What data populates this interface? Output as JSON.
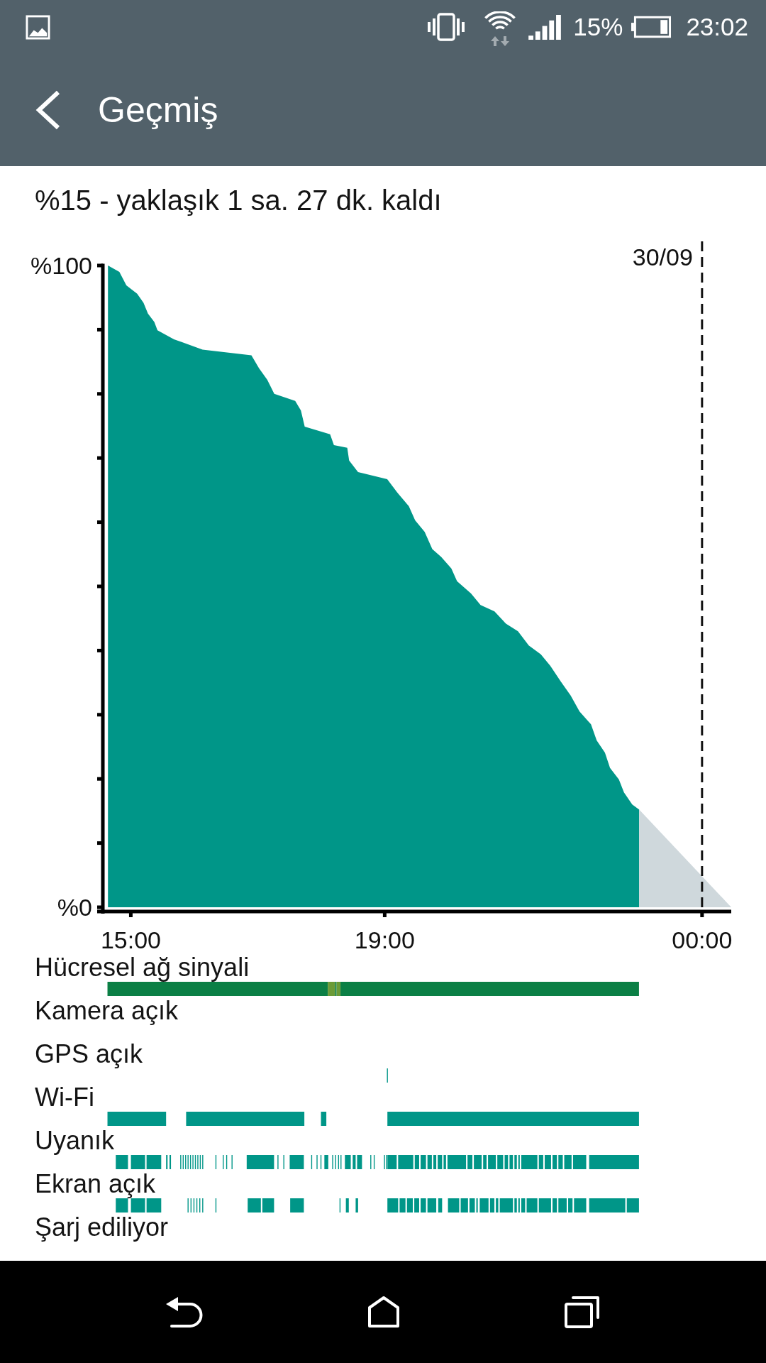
{
  "status_bar": {
    "battery_percent": "15%",
    "time": "23:02"
  },
  "app_bar": {
    "title": "Geçmiş"
  },
  "summary": "%15 - yaklaşık 1 sa. 27 dk. kaldı",
  "chart": {
    "date_label": "30/09",
    "chart_data": {
      "type": "area",
      "x": [
        14.64,
        14.82,
        14.93,
        15.1,
        15.2,
        15.27,
        15.37,
        15.42,
        15.68,
        16.13,
        16.9,
        17.02,
        17.15,
        17.26,
        17.59,
        17.68,
        17.74,
        18.14,
        18.2,
        18.41,
        18.44,
        18.58,
        19.04,
        19.2,
        19.38,
        19.48,
        19.63,
        19.75,
        19.89,
        20.05,
        20.14,
        20.36,
        20.51,
        20.73,
        20.91,
        21.1,
        21.27,
        21.46,
        21.61,
        21.78,
        21.93,
        22.07,
        22.25,
        22.34,
        22.47,
        22.55,
        22.69,
        22.77,
        22.9,
        23.01,
        24.46
      ],
      "series": [
        {
          "color": "#009688",
          "values": [
            100,
            99,
            96.9,
            95.6,
            94.2,
            92.5,
            91.2,
            89.9,
            88.5,
            86.9,
            86,
            84,
            82.2,
            80,
            78.9,
            77.4,
            74.9,
            73.7,
            72,
            71.6,
            69.6,
            67.8,
            66.7,
            64.6,
            62.5,
            60.3,
            58.5,
            55.8,
            54.6,
            52.8,
            50.8,
            48.9,
            47.1,
            46.1,
            44.2,
            43,
            40.8,
            39.4,
            37.6,
            35.1,
            33,
            30.5,
            28.5,
            26,
            24.1,
            21.7,
            19.9,
            17.9,
            16,
            15.2,
            null
          ]
        },
        {
          "color": "#cfd8dc",
          "values": [
            null,
            null,
            null,
            null,
            null,
            null,
            null,
            null,
            null,
            null,
            null,
            null,
            null,
            null,
            null,
            null,
            null,
            null,
            null,
            null,
            null,
            null,
            null,
            null,
            null,
            null,
            null,
            null,
            null,
            null,
            null,
            null,
            null,
            null,
            null,
            null,
            null,
            null,
            null,
            null,
            null,
            null,
            null,
            null,
            null,
            null,
            null,
            null,
            null,
            15.2,
            0
          ]
        }
      ],
      "xlim": [
        14.47,
        24.46
      ],
      "ylim": [
        0,
        100
      ],
      "xticks": [
        {
          "value": 15,
          "label": "15:00"
        },
        {
          "value": 19,
          "label": "19:00"
        },
        {
          "value": 24,
          "label": "00:00"
        }
      ],
      "yticks": [
        {
          "value": 0,
          "label": "%0"
        },
        {
          "value": 100,
          "label": "%100"
        }
      ],
      "ref_lines": [
        {
          "axis": "x",
          "value": 24
        }
      ]
    }
  },
  "activity": [
    {
      "label": "Hücresel ağ sinyali",
      "kind": "signal"
    },
    {
      "label": "Kamera açık",
      "kind": "camera"
    },
    {
      "label": "GPS açık",
      "kind": "gps"
    },
    {
      "label": "Wi-Fi",
      "kind": "wifi"
    },
    {
      "label": "Uyanık",
      "kind": "awake"
    },
    {
      "label": "Ekran açık",
      "kind": "screen"
    },
    {
      "label": "Şarj ediliyor",
      "kind": "charging"
    }
  ]
}
